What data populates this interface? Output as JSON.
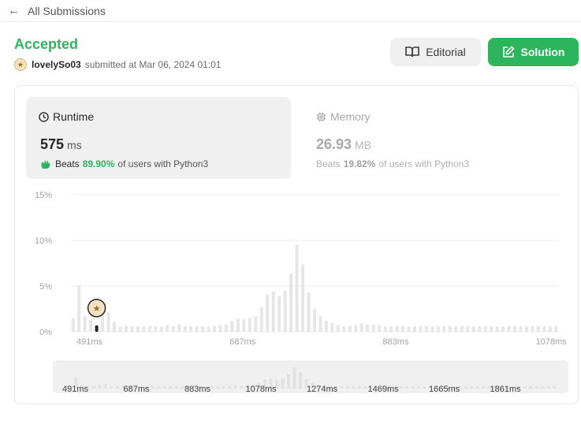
{
  "nav": {
    "back_label": "All Submissions",
    "back_icon": "arrow-left-icon"
  },
  "submission": {
    "status": "Accepted",
    "username": "lovelySo03",
    "submitted_text": "submitted at Mar 06, 2024 01:01"
  },
  "actions": {
    "editorial_label": "Editorial",
    "solution_label": "Solution"
  },
  "runtime": {
    "title": "Runtime",
    "value": "575",
    "unit": "ms",
    "beats_label": "Beats",
    "beats_pct": "89.90%",
    "beats_suffix": "of users with Python3"
  },
  "memory": {
    "title": "Memory",
    "value": "26.93",
    "unit": "MB",
    "beats_label": "Beats",
    "beats_pct": "19.82%",
    "beats_suffix": "of users with Python3"
  },
  "colors": {
    "accent": "#2db55d",
    "bar": "#e6e6e6",
    "bar_highlight": "#262626"
  },
  "chart_data": {
    "type": "bar",
    "title": "",
    "xlabel": "",
    "ylabel": "",
    "ylim": [
      0,
      15
    ],
    "y_ticks": [
      "15%",
      "10%",
      "5%",
      "0%"
    ],
    "x_tick_labels": [
      "491ms",
      "687ms",
      "883ms",
      "1078ms",
      "1274ms",
      "1469ms",
      "1665ms",
      "1861ms"
    ],
    "highlight_index": 4,
    "highlight_label": "575ms",
    "values": [
      1.5,
      5.1,
      1.7,
      1.2,
      0.7,
      1.5,
      2.1,
      1.1,
      0.6,
      0.6,
      0.6,
      0.6,
      0.6,
      0.6,
      0.6,
      0.6,
      0.7,
      0.6,
      0.8,
      0.6,
      0.6,
      0.6,
      0.6,
      0.6,
      0.6,
      0.7,
      0.8,
      1.2,
      1.4,
      1.4,
      1.5,
      1.7,
      2.7,
      4.1,
      4.4,
      3.9,
      4.5,
      6.4,
      9.5,
      7.4,
      4.3,
      2.5,
      1.7,
      1.2,
      1.0,
      0.7,
      0.6,
      0.6,
      0.7,
      0.9,
      0.8,
      0.8,
      0.7,
      0.6,
      0.6,
      0.6,
      0.6,
      0.6,
      0.6,
      0.6,
      0.6,
      0.6,
      0.6,
      0.6,
      0.6,
      0.6,
      0.6,
      0.6,
      0.6,
      0.6,
      0.6,
      0.6,
      0.6,
      0.6,
      0.6,
      0.6,
      0.6,
      0.6,
      0.6,
      0.6,
      0.6,
      0.6,
      0.6
    ]
  }
}
